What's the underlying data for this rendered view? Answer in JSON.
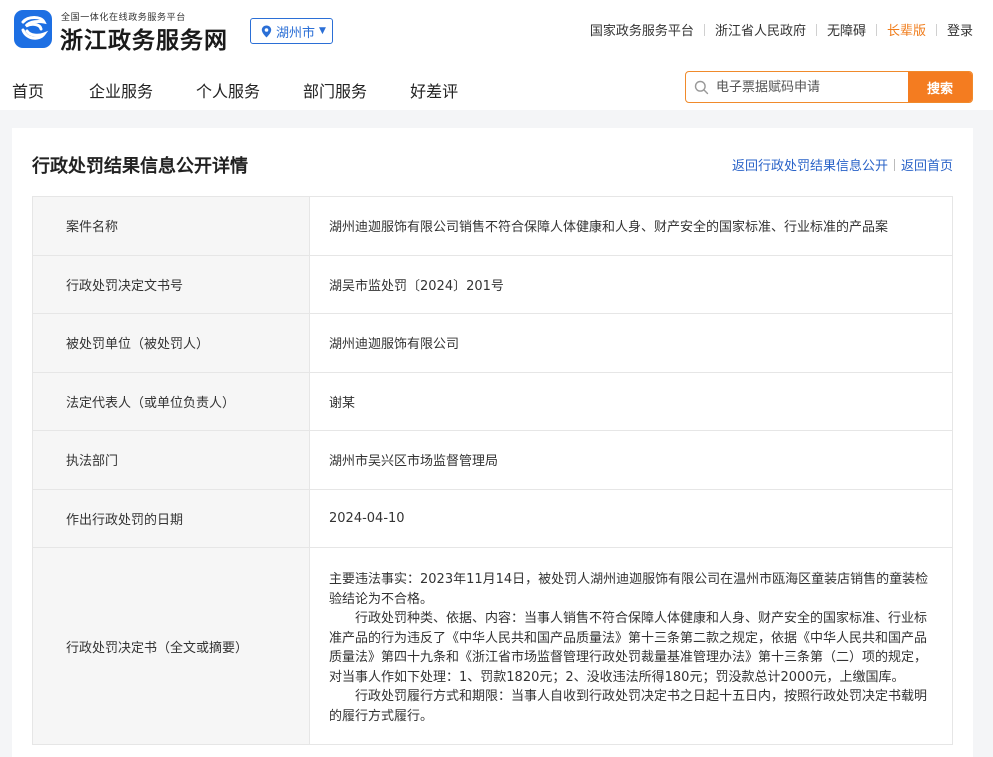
{
  "header": {
    "logo_sub": "全国一体化在线政务服务平台",
    "logo_title": "浙江政务服务网",
    "region": "湖州市",
    "top_links": [
      "国家政务服务平台",
      "浙江省人民政府",
      "无障碍",
      "长辈版",
      "登录"
    ]
  },
  "nav": {
    "items": [
      "首页",
      "企业服务",
      "个人服务",
      "部门服务",
      "好差评"
    ]
  },
  "search": {
    "placeholder": "电子票据赋码申请",
    "button": "搜索"
  },
  "page": {
    "title": "行政处罚结果信息公开详情",
    "back_list": "返回行政处罚结果信息公开",
    "back_home": "返回首页"
  },
  "detail": {
    "rows": [
      {
        "label": "案件名称",
        "value": "湖州迪迦服饰有限公司销售不符合保障人体健康和人身、财产安全的国家标准、行业标准的产品案"
      },
      {
        "label": "行政处罚决定文书号",
        "value": "湖吴市监处罚〔2024〕201号"
      },
      {
        "label": "被处罚单位（被处罚人）",
        "value": "湖州迪迦服饰有限公司"
      },
      {
        "label": "法定代表人（或单位负责人）",
        "value": "谢某"
      },
      {
        "label": "执法部门",
        "value": "湖州市吴兴区市场监督管理局"
      },
      {
        "label": "作出行政处罚的日期",
        "value": "2024-04-10"
      }
    ],
    "decision": {
      "label": "行政处罚决定书（全文或摘要）",
      "p1": "主要违法事实：2023年11月14日，被处罚人湖州迪迦服饰有限公司在温州市瓯海区童装店销售的童装检验结论为不合格。",
      "p2": "行政处罚种类、依据、内容：当事人销售不符合保障人体健康和人身、财产安全的国家标准、行业标准产品的行为违反了《中华人民共和国产品质量法》第十三条第二款之规定，依据《中华人民共和国产品质量法》第四十九条和《浙江省市场监督管理行政处罚裁量基准管理办法》第十三条第（二）项的规定，对当事人作如下处理：1、罚款1820元；2、没收违法所得180元；罚没款总计2000元，上缴国库。",
      "p3": "行政处罚履行方式和期限：当事人自收到行政处罚决定书之日起十五日内，按照行政处罚决定书载明的履行方式履行。"
    }
  },
  "colors": {
    "brand_blue": "#1d6fe3",
    "accent_orange": "#f47c20",
    "link_blue": "#2a63c8"
  }
}
